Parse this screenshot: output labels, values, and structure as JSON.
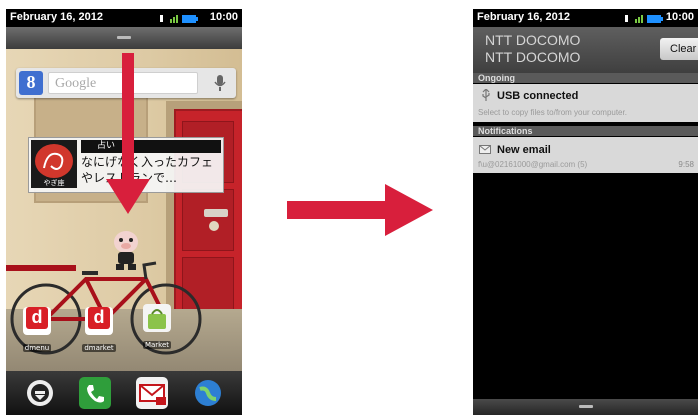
{
  "colors": {
    "arrow_red": "#d81f3c",
    "statusbar_bg": "#000000",
    "door_red": "#c6232a",
    "notif_bg": "#d9d9d9"
  },
  "left_phone": {
    "status_bar": {
      "date": "February 16, 2012",
      "time": "10:00"
    },
    "search_widget": {
      "logo": "8",
      "placeholder": "Google",
      "icon": "mic-icon"
    },
    "news_widget": {
      "category": "占い",
      "headline": "なにげなく入ったカフェやレストランで…",
      "logo_caption": "やぎ座"
    },
    "apps": [
      {
        "label": "dmenu",
        "glyph": "d",
        "icon": "dmenu-icon"
      },
      {
        "label": "dmarket",
        "glyph": "d",
        "icon": "dmarket-icon"
      },
      {
        "label": "Market",
        "glyph": "",
        "icon": "market-bag-icon"
      }
    ],
    "dock": [
      {
        "icon": "app-drawer-icon"
      },
      {
        "icon": "phone-icon"
      },
      {
        "icon": "mail-icon"
      },
      {
        "icon": "globe-browser-icon"
      }
    ]
  },
  "transition_arrow": {
    "icon": "right-arrow-icon"
  },
  "right_phone": {
    "status_bar": {
      "date": "February 16, 2012",
      "time": "10:00"
    },
    "carrier_lines": [
      "NTT DOCOMO",
      "NTT DOCOMO"
    ],
    "clear_label": "Clear",
    "sections": {
      "ongoing": "Ongoing",
      "notifications": "Notifications"
    },
    "usb": {
      "title": "USB connected",
      "subtitle": "Select to copy files to/from your computer.",
      "icon": "usb-icon"
    },
    "email": {
      "title": "New email",
      "subtitle": "f\\u@02161000@gmail.com (5)",
      "time": "9:58",
      "icon": "envelope-icon"
    }
  }
}
